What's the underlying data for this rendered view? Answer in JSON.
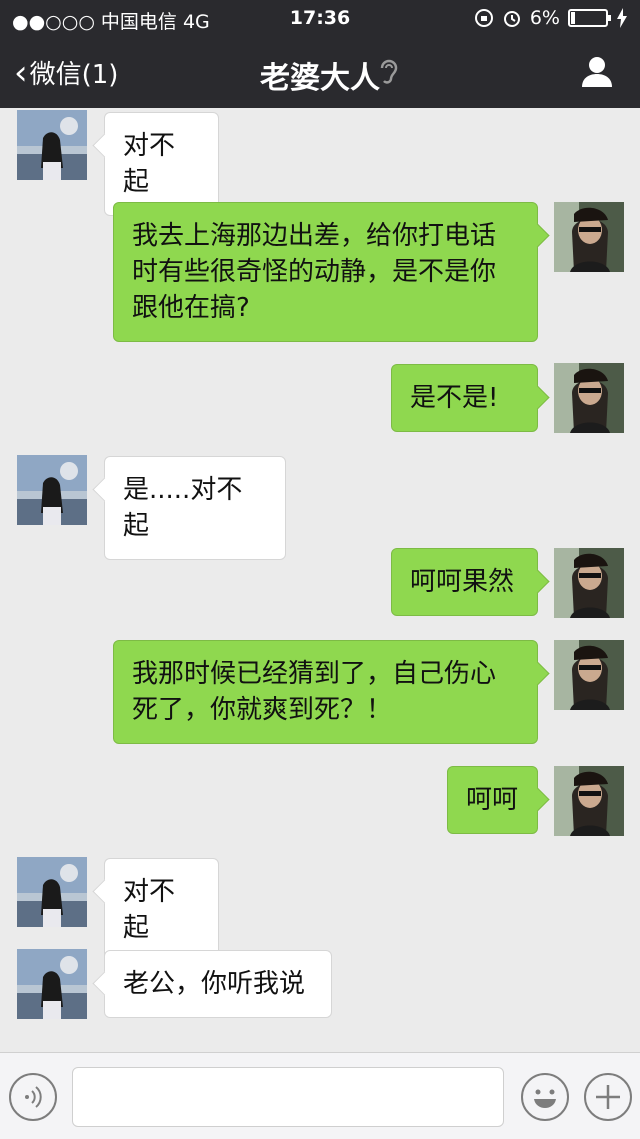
{
  "status_bar": {
    "carrier": "●●○○○ 中国电信  4G",
    "time": "17:36",
    "battery": "6%"
  },
  "nav": {
    "back_label": "微信(1)",
    "title": "老婆大人"
  },
  "messages": [
    {
      "side": "in",
      "text": "对不起"
    },
    {
      "side": "out",
      "text": "我去上海那边出差，给你打电话时有些很奇怪的动静，是不是你跟他在搞?"
    },
    {
      "side": "out",
      "text": "是不是!"
    },
    {
      "side": "in",
      "text": "是.....对不起"
    },
    {
      "side": "out",
      "text": "呵呵果然"
    },
    {
      "side": "out",
      "text": "我那时候已经猜到了，自己伤心死了，你就爽到死？！"
    },
    {
      "side": "out",
      "text": "呵呵"
    },
    {
      "side": "in",
      "text": "对不起"
    },
    {
      "side": "in",
      "text": "老公，你听我说"
    }
  ],
  "colors": {
    "header_bg": "#2a2a2e",
    "chat_bg": "#ebebeb",
    "outgoing_bubble": "#8fd84f",
    "incoming_bubble": "#ffffff"
  },
  "icons": [
    "voice-icon",
    "emoji-icon",
    "plus-icon",
    "ear-icon",
    "person-icon",
    "alarm-icon",
    "lock-rotation-icon",
    "charging-icon"
  ]
}
